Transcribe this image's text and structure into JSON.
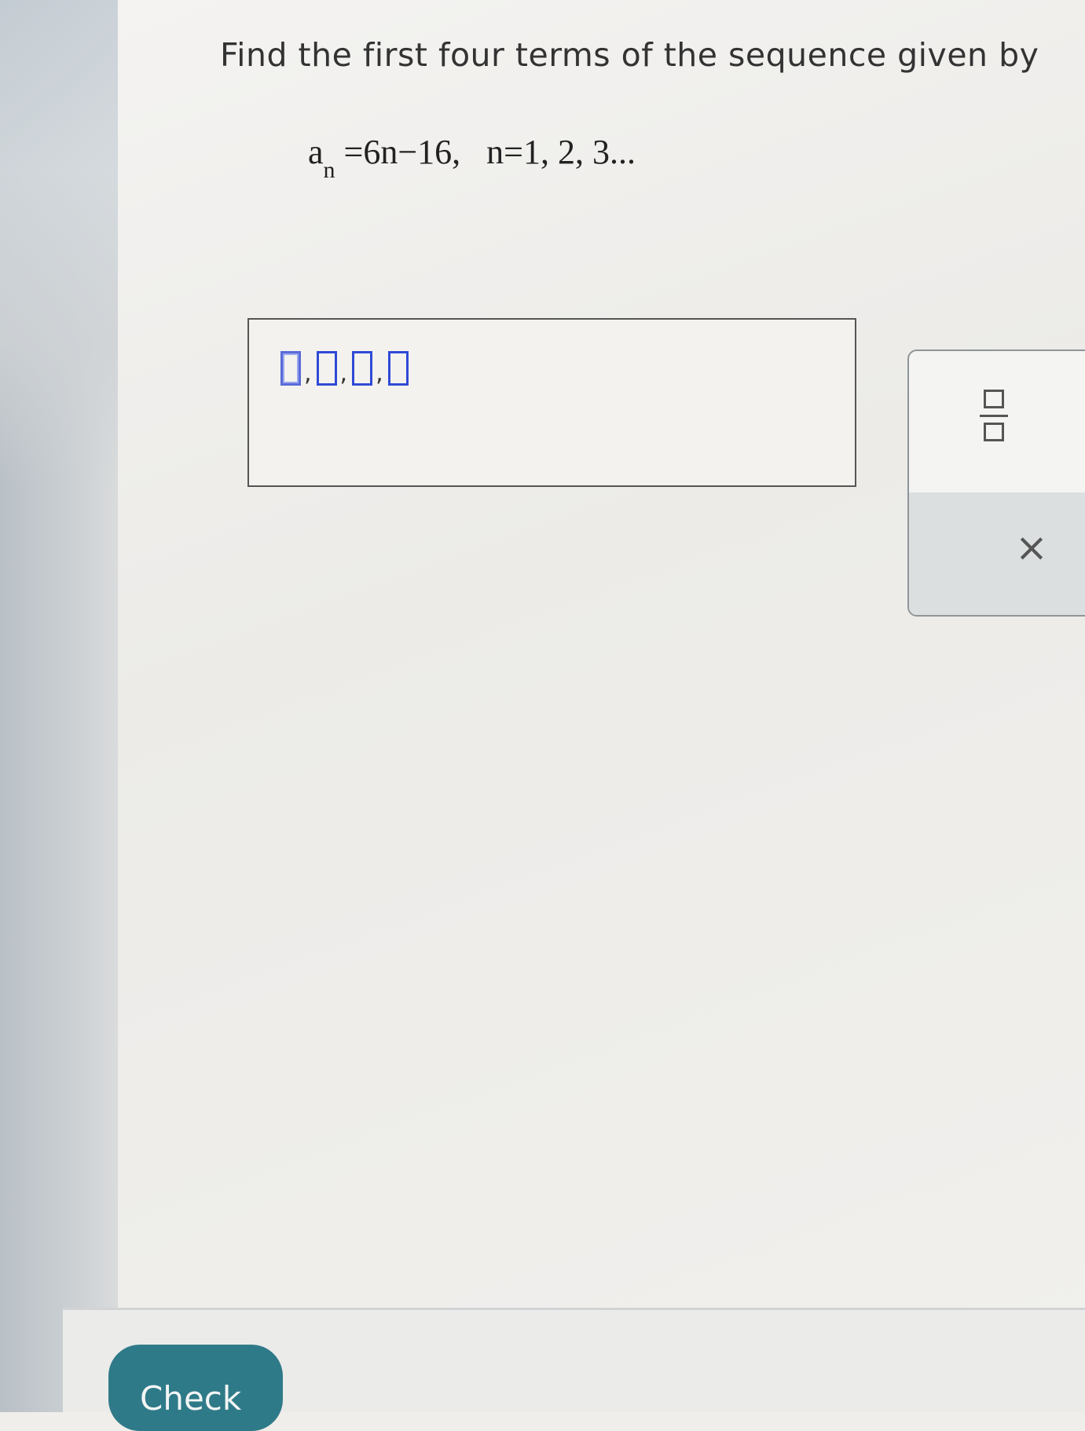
{
  "question": {
    "text": "Find the first four terms of the sequence given by"
  },
  "formula": {
    "lhs_var": "a",
    "lhs_sub": "n",
    "rhs": "=6n−16,",
    "domain": "n=1, 2, 3..."
  },
  "answer": {
    "separators": [
      ",",
      ",",
      ","
    ],
    "slots": [
      "",
      "",
      "",
      ""
    ]
  },
  "tools": {
    "fraction_icon": "fraction-template-icon",
    "close_label": "×"
  },
  "footer": {
    "check_label": "Check"
  },
  "colors": {
    "accent": "#2f7a88",
    "slot_border": "#2f4ad6"
  }
}
